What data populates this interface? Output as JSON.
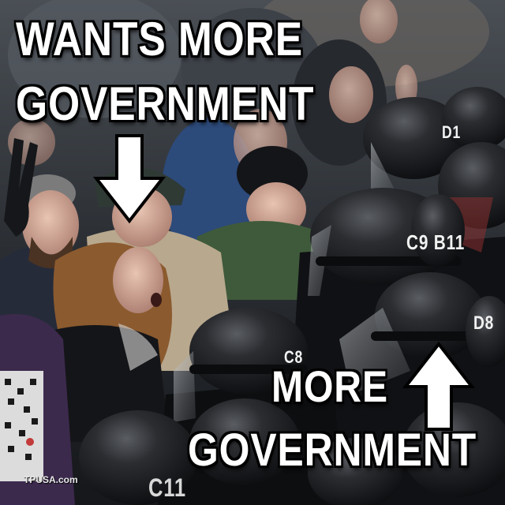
{
  "meme": {
    "top_caption_line1": "WANTS MORE",
    "top_caption_line2": "GOVERNMENT",
    "bottom_caption_line1": "MORE",
    "bottom_caption_line2": "GOVERNMENT",
    "watermark": "TPUSA.com"
  },
  "helmet_labels": {
    "helmet_1": "C9 B11",
    "helmet_2": "C8",
    "helmet_3": "D8",
    "helmet_4": "D1",
    "helmet_5": "C11"
  },
  "arrows": {
    "top": "down-arrow-icon",
    "bottom": "up-arrow-icon"
  },
  "colors": {
    "caption_text": "#ffffff",
    "caption_outline": "#000000",
    "helmet": "#1a1c1f"
  }
}
